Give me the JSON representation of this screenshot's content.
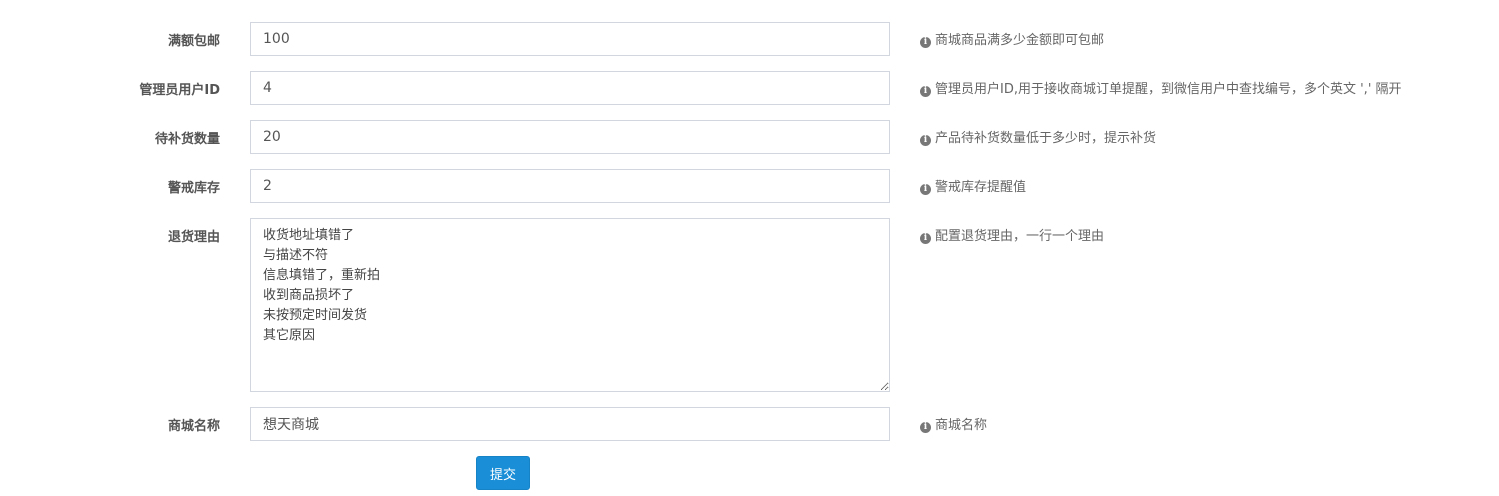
{
  "fields": {
    "free_shipping": {
      "label": "满额包邮",
      "value": "100",
      "help": "商城商品满多少金额即可包邮"
    },
    "admin_user_id": {
      "label": "管理员用户ID",
      "value": "4",
      "help": "管理员用户ID,用于接收商城订单提醒，到微信用户中查找编号，多个英文 ',' 隔开"
    },
    "restock_quantity": {
      "label": "待补货数量",
      "value": "20",
      "help": "产品待补货数量低于多少时，提示补货"
    },
    "stock_warning": {
      "label": "警戒库存",
      "value": "2",
      "help": "警戒库存提醒值"
    },
    "return_reasons": {
      "label": "退货理由",
      "value": "收货地址填错了\n与描述不符\n信息填错了，重新拍\n收到商品损坏了\n未按预定时间发货\n其它原因",
      "help": "配置退货理由，一行一个理由"
    },
    "shop_name": {
      "label": "商城名称",
      "value": "想天商城",
      "help": "商城名称"
    }
  },
  "info_icon_glyph": "i",
  "submit_label": "提交",
  "colors": {
    "primary": "#1a8fd8",
    "border": "#d2d6de",
    "label": "#555555"
  }
}
